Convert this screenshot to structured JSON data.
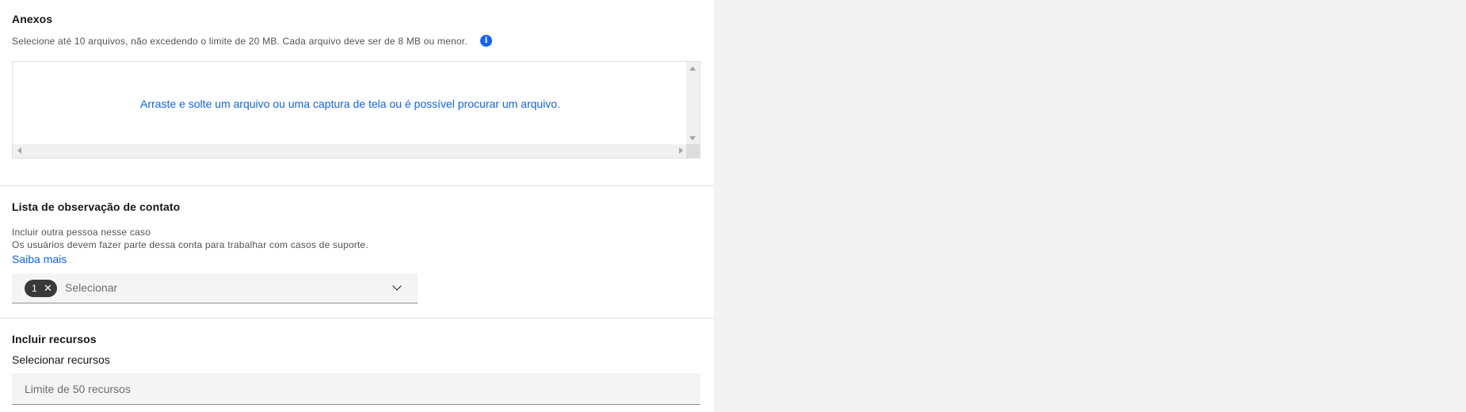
{
  "attachments": {
    "title": "Anexos",
    "helper": "Selecione até 10 arquivos, não excedendo o limite de 20 MB. Cada arquivo deve ser de 8 MB ou menor.",
    "info_icon": "info-icon",
    "dropzone_text": "Arraste e solte um arquivo ou uma captura de tela ou é possível procurar um arquivo."
  },
  "watchlist": {
    "title": "Lista de observação de contato",
    "helper_line1": "Incluir outra pessoa nesse caso",
    "helper_line2": "Os usuários devem fazer parte dessa conta para trabalhar com casos de suporte.",
    "learn_more": "Saiba mais",
    "selected_count": "1",
    "placeholder": "Selecionar"
  },
  "resources": {
    "title": "Incluir recursos",
    "label": "Selecionar recursos",
    "placeholder": "Limite de 50 recursos"
  },
  "colors": {
    "link": "#0f62fe",
    "panel_bg": "#ffffff",
    "page_bg": "#f2f2f2",
    "tag_bg": "#393939"
  }
}
